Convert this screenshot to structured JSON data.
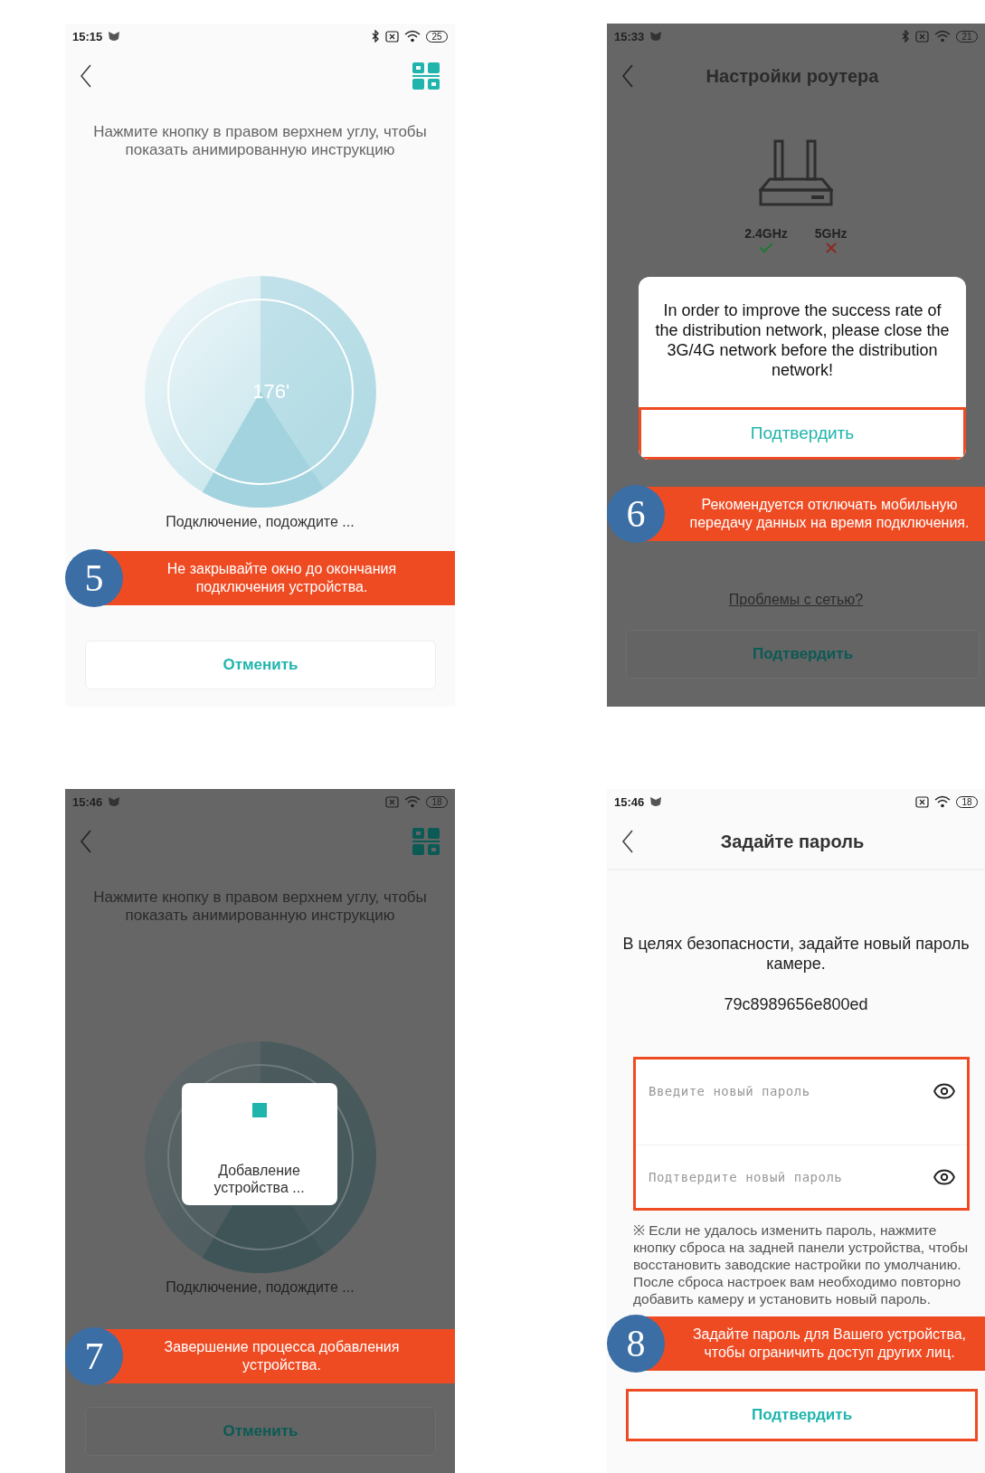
{
  "panels": [
    {
      "kind": "connecting",
      "dimmed": false,
      "status_bar": {
        "time": "15:15",
        "bluetooth": true,
        "battery": "25"
      },
      "hint": "Нажмите кнопку в правом верхнем углу, чтобы показать анимированную инструкцию",
      "progress_label": "176'",
      "status": "Подключение, подождите ...",
      "callout": {
        "number": "5",
        "text": "Не закрывайте окно до окончания подключения устройства."
      },
      "cancel_button": "Отменить"
    },
    {
      "kind": "router",
      "dimmed": true,
      "status_bar": {
        "time": "15:33",
        "bluetooth": true,
        "battery": "21"
      },
      "title": "Настройки роутера",
      "bands": [
        {
          "label": "2.4GHz",
          "ok": true
        },
        {
          "label": "5GHz",
          "ok": false
        }
      ],
      "dialog": {
        "message": "In order to improve the success rate of the distribution network, please close the 3G/4G network before the distribution network!",
        "confirm_button": "Подтвердить",
        "highlighted": true
      },
      "callout": {
        "number": "6",
        "text": "Рекомендуется отключать мобильную передачу данных на время подключения."
      },
      "network_link": "Проблемы с сетью?",
      "confirm_button": "Подтвердить"
    },
    {
      "kind": "connecting",
      "dimmed": true,
      "status_bar": {
        "time": "15:46",
        "bluetooth": false,
        "battery": "18"
      },
      "hint": "Нажмите кнопку в правом верхнем углу, чтобы показать анимированную инструкцию",
      "popup": "Добавление устройства ...",
      "status": "Подключение, подождите ...",
      "callout": {
        "number": "7",
        "text": "Завершение процесса добавления устройства."
      },
      "cancel_button": "Отменить"
    },
    {
      "kind": "password",
      "dimmed": false,
      "status_bar": {
        "time": "15:46",
        "bluetooth": false,
        "battery": "18"
      },
      "title": "Задайте пароль",
      "message": "В целях безопасности, задайте новый пароль камере.",
      "device_id": "79c8989656e800ed",
      "fields_highlighted": true,
      "fields": [
        {
          "placeholder": "Введите новый пароль"
        },
        {
          "placeholder": "Подтвердите новый пароль"
        }
      ],
      "note": "※ Если не удалось изменить пароль, нажмите кнопку сброса на задней панели устройства, чтобы восстановить заводские настройки по умолчанию. После сброса настроек вам необходимо повторно добавить камеру и установить новый пароль.",
      "callout": {
        "number": "8",
        "text": "Задайте пароль для Вашего устройства, чтобы ограничить доступ других лиц."
      },
      "confirm_button": "Подтвердить",
      "confirm_highlighted": true
    }
  ]
}
